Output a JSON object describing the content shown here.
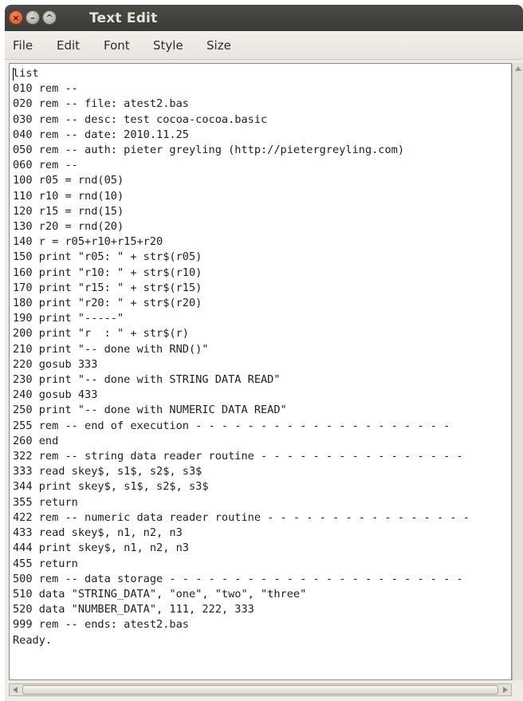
{
  "window": {
    "title": "Text Edit",
    "controls": {
      "close_glyph": "×",
      "minimize_glyph": "–",
      "maximize_glyph": "^",
      "close_icon": "close-icon",
      "minimize_icon": "minimize-icon",
      "maximize_icon": "maximize-icon"
    }
  },
  "menu": {
    "file": "File",
    "edit": "Edit",
    "font": "Font",
    "style": "Style",
    "size": "Size"
  },
  "editor": {
    "text": "list\n010 rem --\n020 rem -- file: atest2.bas\n030 rem -- desc: test cocoa-cocoa.basic\n040 rem -- date: 2010.11.25\n050 rem -- auth: pieter greyling (http://pietergreyling.com)\n060 rem --\n100 r05 = rnd(05)\n110 r10 = rnd(10)\n120 r15 = rnd(15)\n130 r20 = rnd(20)\n140 r = r05+r10+r15+r20\n150 print \"r05: \" + str$(r05)\n160 print \"r10: \" + str$(r10)\n170 print \"r15: \" + str$(r15)\n180 print \"r20: \" + str$(r20)\n190 print \"-----\"\n200 print \"r  : \" + str$(r)\n210 print \"-- done with RND()\"\n220 gosub 333\n230 print \"-- done with STRING DATA READ\"\n240 gosub 433\n250 print \"-- done with NUMERIC DATA READ\"\n255 rem -- end of execution - - - - - - - - - - - - - - - - - - - -\n260 end\n322 rem -- string data reader routine - - - - - - - - - - - - - - - -\n333 read skey$, s1$, s2$, s3$\n344 print skey$, s1$, s2$, s3$\n355 return\n422 rem -- numeric data reader routine - - - - - - - - - - - - - - - -\n433 read skey$, n1, n2, n3\n444 print skey$, n1, n2, n3\n455 return\n500 rem -- data storage - - - - - - - - - - - - - - - - - - - - - - -\n510 data \"STRING_DATA\", \"one\", \"two\", \"three\"\n520 data \"NUMBER_DATA\", 111, 222, 333\n999 rem -- ends: atest2.bas\nReady."
  },
  "colors": {
    "titlebar": "#3f3f3c",
    "close_button": "#e0622e",
    "window_bg": "#efebe7",
    "editor_bg": "#ffffff"
  }
}
